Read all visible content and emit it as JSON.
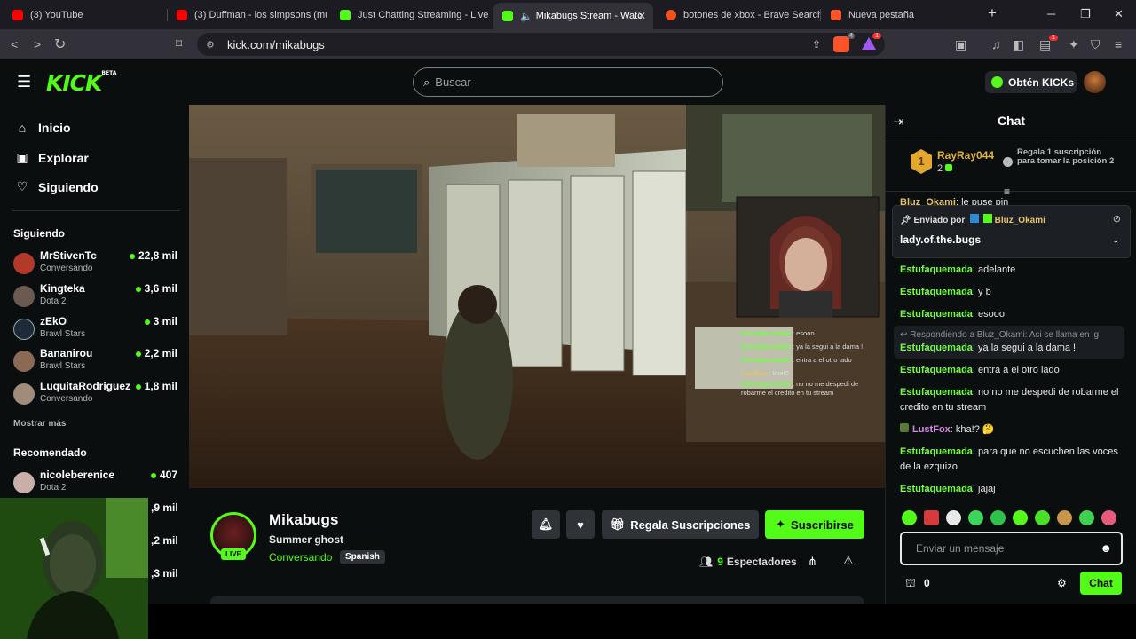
{
  "browser": {
    "tabs": [
      {
        "label": "(3) YouTube",
        "fav_color": "#ff0000"
      },
      {
        "label": "(3) Duffman - los simpsons (mus",
        "fav_color": "#ff0000"
      },
      {
        "label": "Just Chatting Streaming - Live St",
        "fav_color": "#53fc18"
      },
      {
        "label": "Mikabugs Stream - Watc",
        "fav_color": "#53fc18"
      },
      {
        "label": "botones de xbox - Brave Search",
        "fav_color": "#f4511e"
      },
      {
        "label": "Nueva pestaña",
        "fav_color": "#fb542b"
      }
    ],
    "url": "kick.com/mikabugs",
    "brave_badge": "4",
    "rewards_badge": "1",
    "wallet_badge": "1"
  },
  "header": {
    "logo": "KICK",
    "logo_beta": "BETA",
    "search_placeholder": "Buscar",
    "kicks_label": "Obtén KICKs"
  },
  "sidebar": {
    "nav": [
      {
        "label": "Inicio",
        "icon": "home-icon"
      },
      {
        "label": "Explorar",
        "icon": "explore-icon"
      },
      {
        "label": "Siguiendo",
        "icon": "heart-icon"
      }
    ],
    "following_title": "Siguiendo",
    "following": [
      {
        "name": "MrStivenTc",
        "category": "Conversando",
        "viewers": "22,8 mil",
        "color": "#b33a2a"
      },
      {
        "name": "Kingteka",
        "category": "Dota 2",
        "viewers": "3,6 mil",
        "color": "#6a5a50"
      },
      {
        "name": "zEkO",
        "category": "Brawl Stars",
        "viewers": "3 mil",
        "color": "#1e2a3a"
      },
      {
        "name": "Bananirou",
        "category": "Brawl Stars",
        "viewers": "2,2 mil",
        "color": "#8a6a55"
      },
      {
        "name": "LuquitaRodriguez",
        "category": "Conversando",
        "viewers": "1,8 mil",
        "color": "#a08c7a"
      }
    ],
    "show_more": "Mostrar más",
    "recommended_title": "Recomendado",
    "recommended": [
      {
        "name": "nicoleberenice",
        "category": "Dota 2",
        "viewers": "407",
        "color": "#c8b0a8"
      }
    ],
    "partial_viewers": [
      ",9 mil",
      ",2 mil",
      ",3 mil"
    ]
  },
  "stream": {
    "streamer": "Mikabugs",
    "title": "Summer ghost",
    "category": "Conversando",
    "language": "Spanish",
    "live_badge": "LIVE",
    "gift_label": "Regala Suscripciones",
    "subscribe_label": "Suscribirse",
    "viewers_count": "9",
    "viewers_label": "Espectadores",
    "overlay_chat": [
      {
        "user": "Estufaquemada",
        "text": "esooo"
      },
      {
        "user": "Estufaquemada",
        "text": "ya la segui a la dama !"
      },
      {
        "user": "Estufaquemada",
        "text": "entra a el otro lado"
      },
      {
        "user": "LustFox",
        "text": "kha!?"
      },
      {
        "user": "Estufaquemada",
        "text": "no no me despedi de robarme el credito en tu stream"
      }
    ]
  },
  "chat": {
    "title": "Chat",
    "leader_name": "RayRay044",
    "leader_rank": "1",
    "leader_count": "2",
    "gift_prompt": "Regala 1 suscripción para tomar la posición 2",
    "partial_line_user": "Bluz_Okami",
    "partial_line_text": "le puse pin",
    "pinned_by_label": "Enviado por",
    "pinned_user": "Bluz_Okami",
    "pinned_text": "lady.of.the.bugs",
    "messages": [
      {
        "user": "Estufaquemada",
        "text": "adelante"
      },
      {
        "user": "Estufaquemada",
        "text": "y b"
      },
      {
        "user": "Estufaquemada",
        "text": "esooo"
      },
      {
        "reply_to": "Respondiendo a Bluz_Okami: Asi se llama en ig",
        "user": "Estufaquemada",
        "text": "ya la segui a la dama !"
      },
      {
        "user": "Estufaquemada",
        "text": "entra a el otro lado"
      },
      {
        "user": "Estufaquemada",
        "text": "no no me despedi de robarme el credito en tu stream"
      },
      {
        "user": "LustFox",
        "text": "kha!? 🤔"
      },
      {
        "user": "Estufaquemada",
        "text": "para que no escuchen las voces de la ezquizo"
      },
      {
        "user": "Estufaquemada",
        "text": "jajaj"
      }
    ],
    "input_placeholder": "Enviar un mensaje",
    "points": "0",
    "send_label": "Chat"
  }
}
